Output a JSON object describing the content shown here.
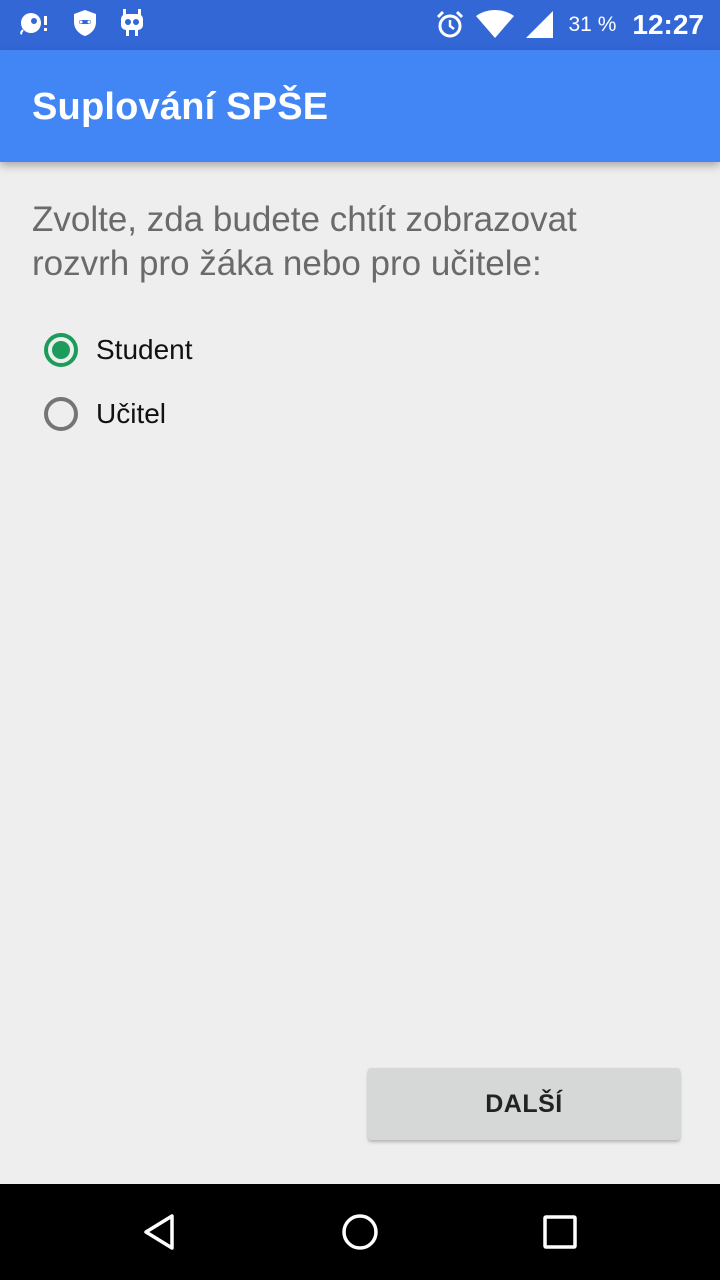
{
  "status_bar": {
    "battery_percent": "31 %",
    "time": "12:27",
    "icons": [
      "notification-icon",
      "shield-icon",
      "cyanogen-icon",
      "alarm-icon",
      "wifi-icon",
      "signal-icon",
      "battery-icon"
    ]
  },
  "app_bar": {
    "title": "Suplování SPŠE"
  },
  "main": {
    "prompt": "Zvolte, zda budete chtít zobrazovat rozvrh pro žáka nebo pro učitele:",
    "options": [
      {
        "label": "Student",
        "selected": true
      },
      {
        "label": "Učitel",
        "selected": false
      }
    ],
    "next_button": "DALŠÍ"
  },
  "nav_bar": {
    "buttons": [
      "back-icon",
      "home-icon",
      "recents-icon"
    ]
  },
  "colors": {
    "status_bar": "#3367D6",
    "app_bar": "#4285F4",
    "accent": "#1B9C5A",
    "background": "#EEEEEE"
  }
}
